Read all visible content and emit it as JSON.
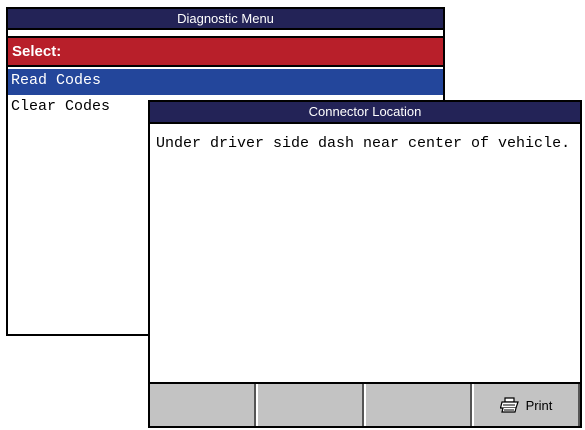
{
  "menu_window": {
    "title": "Diagnostic Menu",
    "select_label": "Select:",
    "items": [
      {
        "label": "Read Codes",
        "selected": true
      },
      {
        "label": "Clear Codes",
        "selected": false
      }
    ]
  },
  "connector_window": {
    "title": "Connector Location",
    "body_text": "Under driver side dash near center of vehicle.",
    "buttons": [
      {
        "label": "",
        "icon": ""
      },
      {
        "label": "",
        "icon": ""
      },
      {
        "label": "",
        "icon": ""
      },
      {
        "label": "Print",
        "icon": "printer-icon"
      }
    ]
  },
  "colors": {
    "titlebar": "#232357",
    "select_bar": "#b81f2a",
    "selected_item": "#23469b",
    "toolbar": "#c3c3c3"
  }
}
